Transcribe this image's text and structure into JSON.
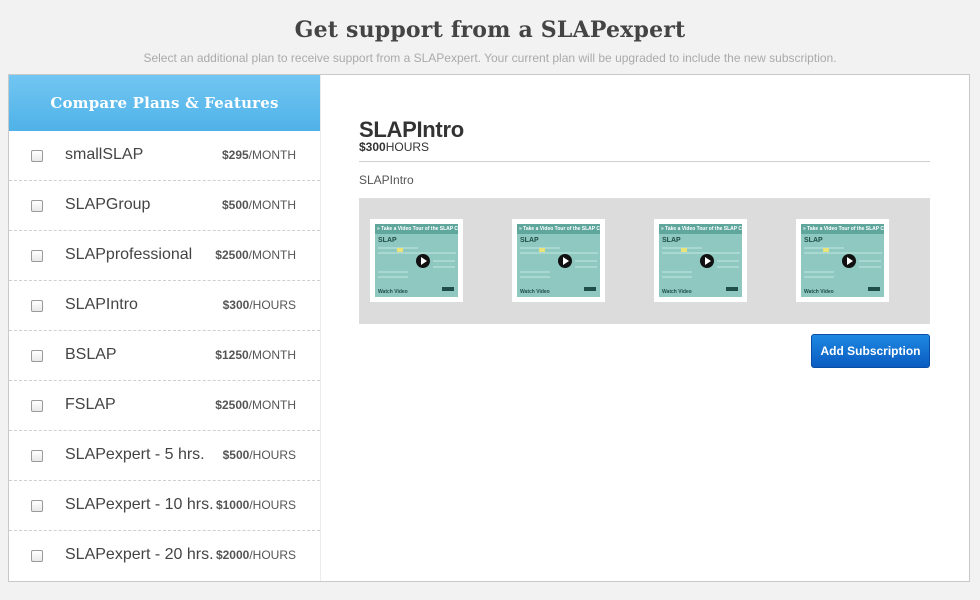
{
  "header": {
    "title": "Get support from a SLAPexpert",
    "subtitle": "Select an additional plan to receive support from a SLAPexpert. Your current plan will be upgraded to include the new subscription."
  },
  "sidebar": {
    "title": "Compare Plans & Features",
    "plans": [
      {
        "name": "smallSLAP",
        "amount": "$295",
        "unit": "/MONTH",
        "checked": false
      },
      {
        "name": "SLAPGroup",
        "amount": "$500",
        "unit": "/MONTH",
        "checked": false
      },
      {
        "name": "SLAPprofessional",
        "amount": "$2500",
        "unit": "/MONTH",
        "checked": false
      },
      {
        "name": "SLAPIntro",
        "amount": "$300",
        "unit": "/HOURS",
        "checked": false
      },
      {
        "name": "BSLAP",
        "amount": "$1250",
        "unit": "/MONTH",
        "checked": false
      },
      {
        "name": "FSLAP",
        "amount": "$2500",
        "unit": "/MONTH",
        "checked": false
      },
      {
        "name": "SLAPexpert - 5 hrs.",
        "amount": "$500",
        "unit": "/HOURS",
        "checked": false
      },
      {
        "name": "SLAPexpert - 10 hrs.",
        "amount": "$1000",
        "unit": "/HOURS",
        "checked": false
      },
      {
        "name": "SLAPexpert - 20 hrs.",
        "amount": "$2000",
        "unit": "/HOURS",
        "checked": false
      }
    ]
  },
  "detail": {
    "title": "SLAPIntro",
    "price_amount": "$300",
    "price_unit": "HOURS",
    "description": "SLAPIntro",
    "videos": [
      {
        "banner": "» Take a Video Tour of the SLAP Center",
        "logo": "SLAP",
        "caption": "Watch Video"
      },
      {
        "banner": "» Take a Video Tour of the SLAP Center",
        "logo": "SLAP",
        "caption": "Watch Video"
      },
      {
        "banner": "» Take a Video Tour of the SLAP Center",
        "logo": "SLAP",
        "caption": "Watch Video"
      },
      {
        "banner": "» Take a Video Tour of the SLAP Center",
        "logo": "SLAP",
        "caption": "Watch Video"
      }
    ],
    "button_label": "Add Subscription"
  },
  "colors": {
    "accent_blue": "#4fb2e8",
    "button_blue": "#0a5cc0",
    "thumb_teal": "#8ec8c0"
  }
}
